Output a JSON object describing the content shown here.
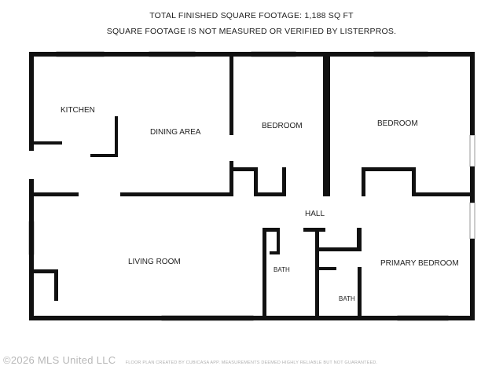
{
  "header": {
    "line1": "TOTAL FINISHED SQUARE FOOTAGE: 1,188 SQ FT",
    "line2": "SQUARE FOOTAGE IS NOT MEASURED OR VERIFIED BY LISTERPROS."
  },
  "rooms": {
    "kitchen": "KITCHEN",
    "dining": "DINING AREA",
    "bedroom_1": "BEDROOM",
    "bedroom_2": "BEDROOM",
    "hall": "HALL",
    "living": "LIVING ROOM",
    "bath_1": "BATH",
    "bath_2": "BATH",
    "primary": "PRIMARY BEDROOM"
  },
  "footer": {
    "copyright": "©2026 MLS United LLC",
    "credit": "FLOOR PLAN CREATED BY CUBICASA APP. MEASUREMENTS DEEMED HIGHLY RELIABLE BUT NOT GUARANTEED."
  },
  "colors": {
    "wall": "#111111",
    "window": "#9a9a9a",
    "text": "#222222"
  }
}
